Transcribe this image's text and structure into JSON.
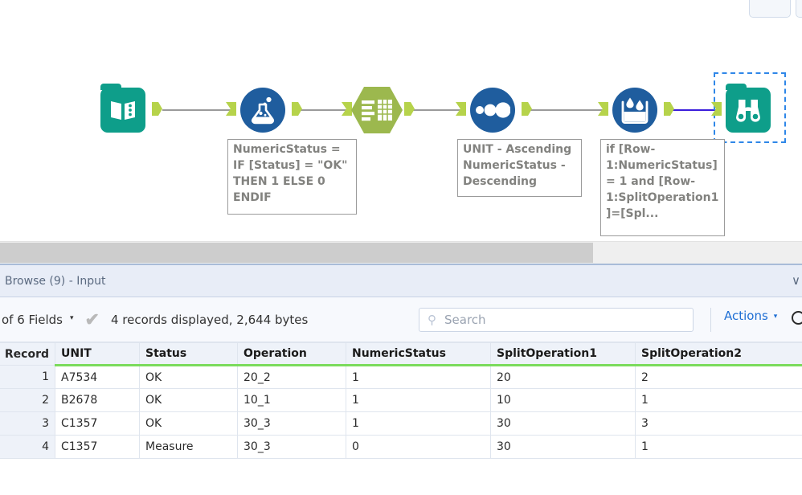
{
  "window": {
    "toolbar_buttons": [
      "",
      ""
    ]
  },
  "canvas": {
    "tools": [
      {
        "id": "input-data",
        "icon": "book-icon",
        "label": "Input Data"
      },
      {
        "id": "formula",
        "icon": "flask-icon",
        "label": "Formula"
      },
      {
        "id": "select",
        "icon": "select-table-icon",
        "label": "Select"
      },
      {
        "id": "sort",
        "icon": "three-circles-icon",
        "label": "Sort"
      },
      {
        "id": "multi-row-formula",
        "icon": "bucket-droplets-icon",
        "label": "Multi-Row Formula"
      },
      {
        "id": "browse",
        "icon": "binoculars-icon",
        "label": "Browse"
      }
    ],
    "annotations": [
      "NumericStatus =\nIF [Status] = \"OK\"\nTHEN 1 ELSE 0\nENDIF",
      "UNIT - Ascending\nNumericStatus -\nDescending",
      "if [Row-\n1:NumericStatus]\n= 1 and [Row-\n1:SplitOperation1\n]=[Spl..."
    ],
    "selected_tool": "browse",
    "colors": {
      "input_output_tool": "#0e9e8a",
      "preparation_tool": "#1f5d9e",
      "select_tool": "#9cb84e",
      "connector": "#9a9a9a",
      "highlight_connector": "#3b1ddb",
      "plug": "#b6d34b",
      "selection": "#2f87e8"
    }
  },
  "results": {
    "browse_tab_title": "Browse (9) - Input",
    "chevron": "∨",
    "toolbar": {
      "fields_label": "of 6 Fields",
      "caret": "▾",
      "check_icon": "✔",
      "records_text": "4 records displayed, 2,644 bytes",
      "search_placeholder": "Search",
      "search_value": "",
      "search_icon": "⚲",
      "actions_label": "Actions",
      "actions_caret": "▾"
    },
    "table": {
      "columns": [
        "Record",
        "UNIT",
        "Status",
        "Operation",
        "NumericStatus",
        "SplitOperation1",
        "SplitOperation2"
      ],
      "rows": [
        [
          "1",
          "A7534",
          "OK",
          "20_2",
          "1",
          "20",
          "2"
        ],
        [
          "2",
          "B2678",
          "OK",
          "10_1",
          "1",
          "10",
          "1"
        ],
        [
          "3",
          "C1357",
          "OK",
          "30_3",
          "1",
          "30",
          "3"
        ],
        [
          "4",
          "C1357",
          "Measure",
          "30_3",
          "0",
          "30",
          "1"
        ]
      ]
    }
  }
}
